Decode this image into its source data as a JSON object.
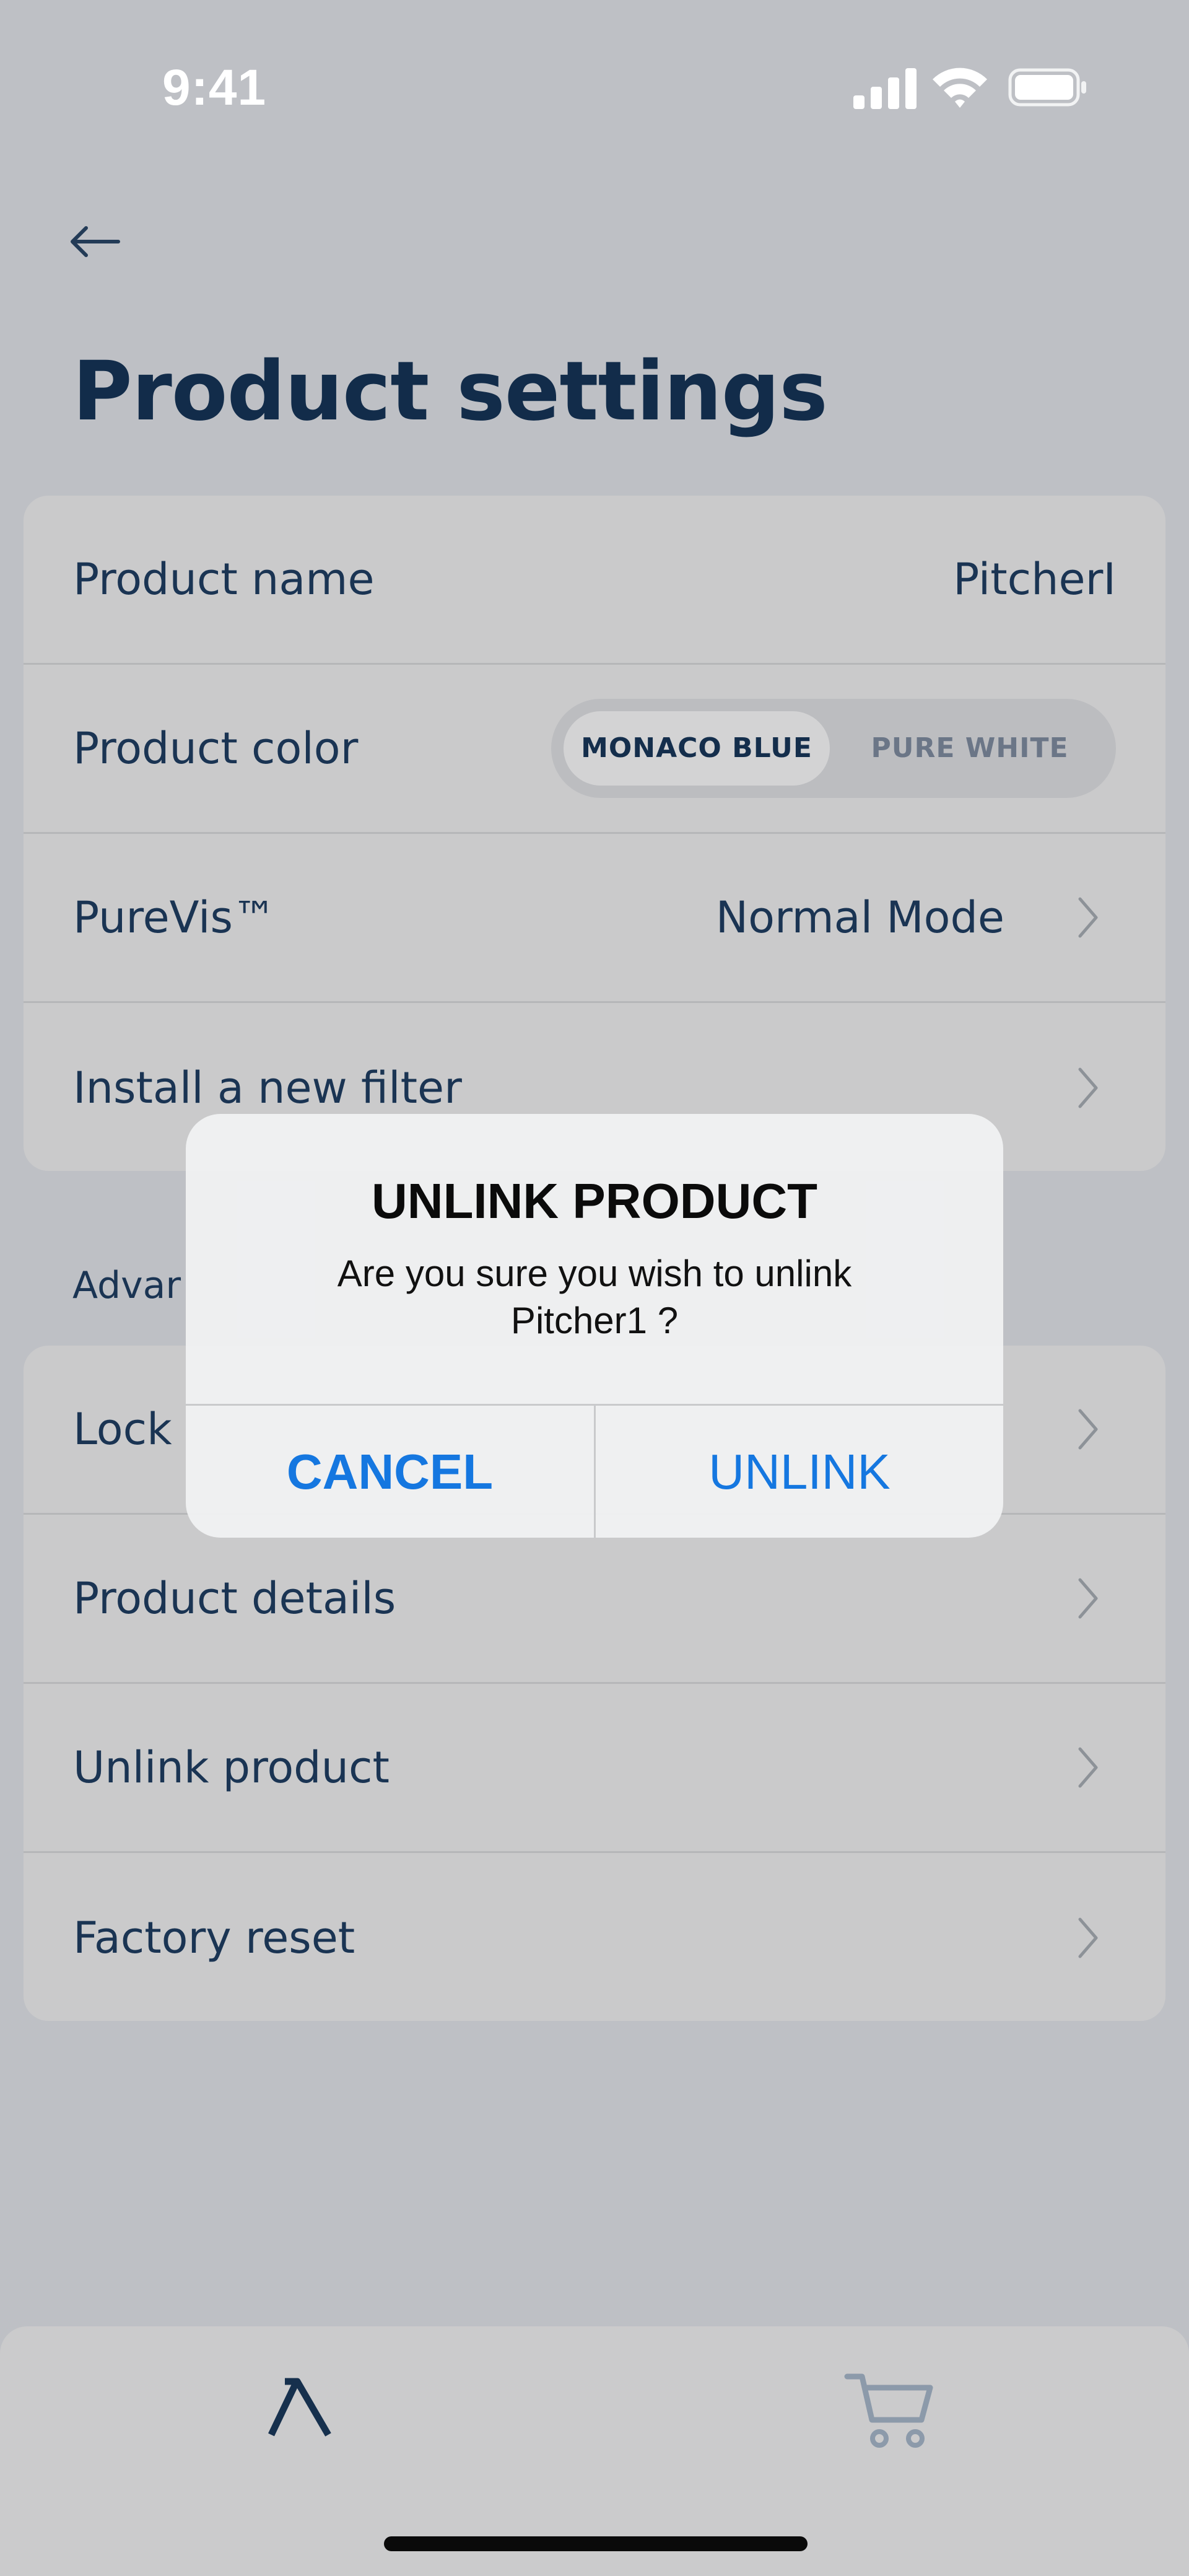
{
  "status_bar": {
    "time": "9:41",
    "icons": [
      "signal-icon",
      "wifi-icon",
      "battery-icon"
    ]
  },
  "header": {
    "back_icon": "arrow-left-icon",
    "title": "Product settings"
  },
  "settings": {
    "product_name_label": "Product name",
    "product_name_value": "PitcherI",
    "product_color_label": "Product color",
    "color_options": [
      "MONACO BLUE",
      "PURE WHITE"
    ],
    "color_selected": "MONACO BLUE",
    "purevis_label": "PureVis™",
    "purevis_value": "Normal Mode",
    "install_filter_label": "Install a new filter"
  },
  "advanced": {
    "section_label": "Advar",
    "lock_label": "Lock",
    "product_details_label": "Product details",
    "unlink_product_label": "Unlink product",
    "factory_reset_label": "Factory reset"
  },
  "alert": {
    "title": "UNLINK PRODUCT",
    "message": "Are you sure you wish to unlink Pitcher1 ?",
    "cancel_label": "CANCEL",
    "confirm_label": "UNLINK"
  },
  "tab_bar": {
    "items": [
      "lambda-home-icon",
      "cart-icon"
    ]
  },
  "colors": {
    "title": "#122c4a",
    "accent_blue": "#1577e0",
    "background": "#bec0c5",
    "card": "#cacacb"
  }
}
